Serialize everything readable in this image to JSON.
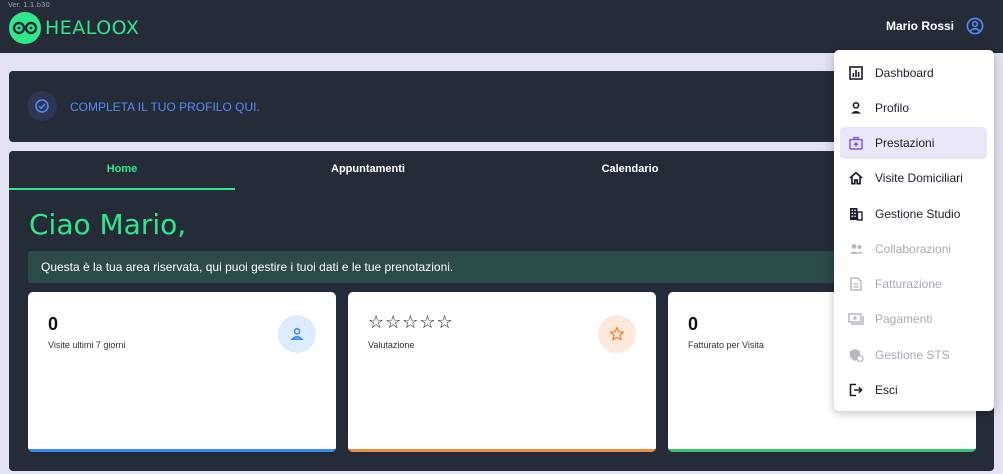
{
  "header": {
    "version": "Ver. 1.1.b30",
    "logo_text": "HEALOOX",
    "user_name": "Mario Rossi"
  },
  "profile_banner": {
    "text": "COMPLETA IL TUO PROFILO QUI."
  },
  "tabs": [
    {
      "label": "Home",
      "active": true
    },
    {
      "label": "Appuntamenti",
      "active": false
    },
    {
      "label": "Calendario",
      "active": false
    }
  ],
  "greeting": "Ciao Mario,",
  "info_message": "Questa è la tua area riservata, qui puoi gestire i tuoi dati e le tue prenotazioni.",
  "stats": [
    {
      "value": "0",
      "label": "Visite ultimi 7 giorni",
      "icon": "person-icon",
      "bar_color": "#3b8cf0"
    },
    {
      "value": "☆☆☆☆☆",
      "label": "Valutazione",
      "icon": "star-icon",
      "bar_color": "#f08a3c"
    },
    {
      "value": "0",
      "label": "Fatturato per Visita",
      "icon": "money-icon",
      "bar_color": "#36c46e"
    }
  ],
  "menu": {
    "items": [
      {
        "label": "Dashboard",
        "icon": "chart-icon",
        "state": "enabled"
      },
      {
        "label": "Profilo",
        "icon": "person-icon",
        "state": "enabled"
      },
      {
        "label": "Prestazioni",
        "icon": "medical-bag-icon",
        "state": "selected"
      },
      {
        "label": "Visite Domiciliari",
        "icon": "home-icon",
        "state": "enabled"
      },
      {
        "label": "Gestione Studio",
        "icon": "building-icon",
        "state": "enabled"
      },
      {
        "label": "Collaborazioni",
        "icon": "group-icon",
        "state": "disabled"
      },
      {
        "label": "Fatturazione",
        "icon": "invoice-icon",
        "state": "disabled"
      },
      {
        "label": "Pagamenti",
        "icon": "payment-icon",
        "state": "disabled"
      },
      {
        "label": "Gestione STS",
        "icon": "sts-icon",
        "state": "disabled"
      },
      {
        "label": "Esci",
        "icon": "logout-icon",
        "state": "enabled"
      }
    ]
  },
  "colors": {
    "accent_green": "#2ee88a",
    "dark_panel": "#262b38",
    "link_blue": "#4f8bf5",
    "selected_bg": "#e9e6f7",
    "prestazioni_icon": "#7b5cd6"
  }
}
